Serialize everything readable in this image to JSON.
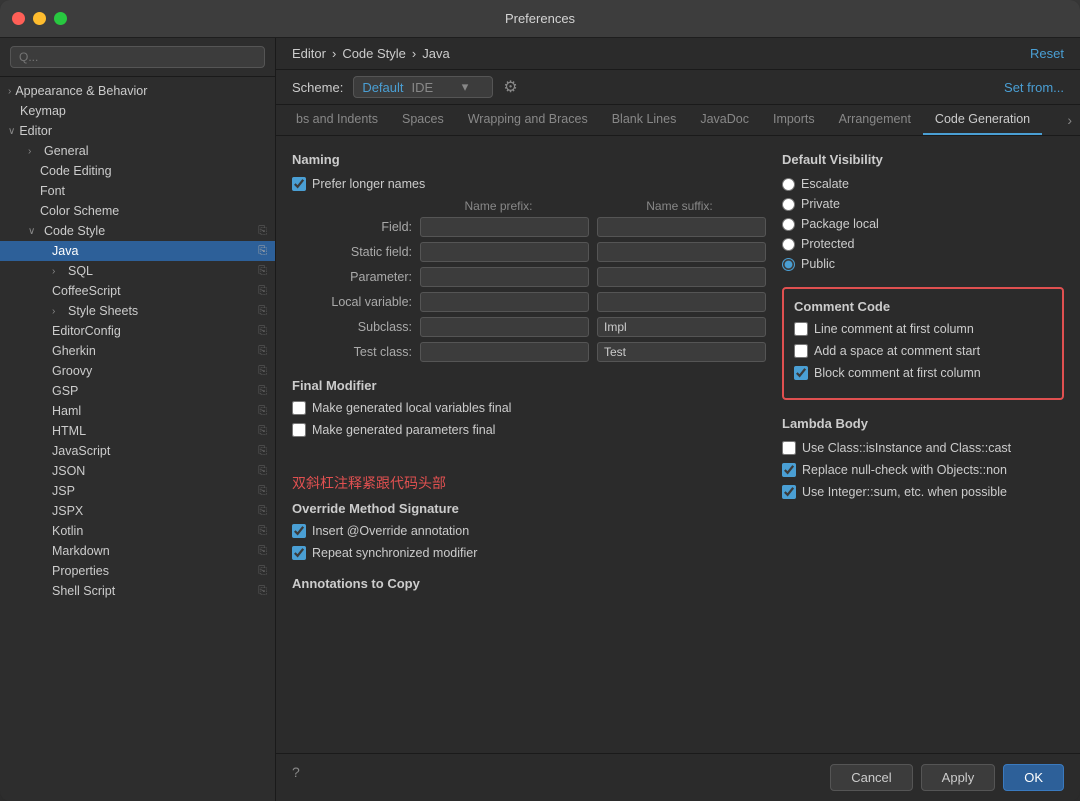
{
  "window": {
    "title": "Preferences"
  },
  "sidebar": {
    "search_placeholder": "Q...",
    "items": [
      {
        "id": "appearance",
        "label": "Appearance & Behavior",
        "indent": 0,
        "arrow": "›",
        "bold": true
      },
      {
        "id": "keymap",
        "label": "Keymap",
        "indent": 1,
        "arrow": ""
      },
      {
        "id": "editor",
        "label": "Editor",
        "indent": 0,
        "arrow": "∨",
        "bold": true
      },
      {
        "id": "general",
        "label": "General",
        "indent": 1,
        "arrow": "›"
      },
      {
        "id": "code-editing",
        "label": "Code Editing",
        "indent": 2,
        "arrow": ""
      },
      {
        "id": "font",
        "label": "Font",
        "indent": 2,
        "arrow": ""
      },
      {
        "id": "color-scheme",
        "label": "Color Scheme",
        "indent": 2,
        "arrow": ""
      },
      {
        "id": "code-style",
        "label": "Code Style",
        "indent": 1,
        "arrow": "∨"
      },
      {
        "id": "java",
        "label": "Java",
        "indent": 2,
        "arrow": "",
        "selected": true
      },
      {
        "id": "sql",
        "label": "SQL",
        "indent": 2,
        "arrow": "›"
      },
      {
        "id": "coffeescript",
        "label": "CoffeeScript",
        "indent": 2,
        "arrow": ""
      },
      {
        "id": "style-sheets",
        "label": "Style Sheets",
        "indent": 2,
        "arrow": "›"
      },
      {
        "id": "editorconfig",
        "label": "EditorConfig",
        "indent": 2,
        "arrow": ""
      },
      {
        "id": "gherkin",
        "label": "Gherkin",
        "indent": 2,
        "arrow": ""
      },
      {
        "id": "groovy",
        "label": "Groovy",
        "indent": 2,
        "arrow": ""
      },
      {
        "id": "gsp",
        "label": "GSP",
        "indent": 2,
        "arrow": ""
      },
      {
        "id": "haml",
        "label": "Haml",
        "indent": 2,
        "arrow": ""
      },
      {
        "id": "html",
        "label": "HTML",
        "indent": 2,
        "arrow": ""
      },
      {
        "id": "javascript",
        "label": "JavaScript",
        "indent": 2,
        "arrow": ""
      },
      {
        "id": "json",
        "label": "JSON",
        "indent": 2,
        "arrow": ""
      },
      {
        "id": "jsp",
        "label": "JSP",
        "indent": 2,
        "arrow": ""
      },
      {
        "id": "jspx",
        "label": "JSPX",
        "indent": 2,
        "arrow": ""
      },
      {
        "id": "kotlin",
        "label": "Kotlin",
        "indent": 2,
        "arrow": ""
      },
      {
        "id": "markdown",
        "label": "Markdown",
        "indent": 2,
        "arrow": ""
      },
      {
        "id": "properties",
        "label": "Properties",
        "indent": 2,
        "arrow": ""
      },
      {
        "id": "shell-script",
        "label": "Shell Script",
        "indent": 2,
        "arrow": ""
      }
    ]
  },
  "breadcrumb": {
    "parts": [
      "Editor",
      "Code Style",
      "Java"
    ],
    "separators": [
      "›",
      "›"
    ]
  },
  "reset_label": "Reset",
  "scheme": {
    "label": "Scheme:",
    "default_text": "Default",
    "ide_text": "IDE",
    "gear_icon": "⚙"
  },
  "set_from_label": "Set from...",
  "tabs": [
    {
      "id": "tabs-indents",
      "label": "bs and Indents"
    },
    {
      "id": "spaces",
      "label": "Spaces"
    },
    {
      "id": "wrapping",
      "label": "Wrapping and Braces"
    },
    {
      "id": "blank-lines",
      "label": "Blank Lines"
    },
    {
      "id": "javadoc",
      "label": "JavaDoc"
    },
    {
      "id": "imports",
      "label": "Imports"
    },
    {
      "id": "arrangement",
      "label": "Arrangement"
    },
    {
      "id": "code-generation",
      "label": "Code Generation",
      "active": true
    }
  ],
  "naming": {
    "title": "Naming",
    "prefer_longer": "Prefer longer names",
    "prefer_longer_checked": true,
    "col_prefix": "Name prefix:",
    "col_suffix": "Name suffix:",
    "rows": [
      {
        "label": "Field:",
        "prefix": "",
        "suffix": ""
      },
      {
        "label": "Static field:",
        "prefix": "",
        "suffix": ""
      },
      {
        "label": "Parameter:",
        "prefix": "",
        "suffix": ""
      },
      {
        "label": "Local variable:",
        "prefix": "",
        "suffix": ""
      },
      {
        "label": "Subclass:",
        "prefix": "",
        "suffix": "Impl"
      },
      {
        "label": "Test class:",
        "prefix": "",
        "suffix": "Test"
      }
    ]
  },
  "default_visibility": {
    "title": "Default Visibility",
    "options": [
      {
        "label": "Escalate",
        "selected": false
      },
      {
        "label": "Private",
        "selected": false
      },
      {
        "label": "Package local",
        "selected": false
      },
      {
        "label": "Protected",
        "selected": false
      },
      {
        "label": "Public",
        "selected": true
      }
    ]
  },
  "final_modifier": {
    "title": "Final Modifier",
    "options": [
      {
        "label": "Make generated local variables final",
        "checked": false
      },
      {
        "label": "Make generated parameters final",
        "checked": false
      }
    ]
  },
  "comment_code": {
    "title": "Comment Code",
    "options": [
      {
        "label": "Line comment at first column",
        "checked": false
      },
      {
        "label": "Add a space at comment start",
        "checked": false
      },
      {
        "label": "Block comment at first column",
        "checked": true
      }
    ]
  },
  "chinese_annotation": "双斜杠注释紧跟代码头部",
  "override_method": {
    "title": "Override Method Signature",
    "options": [
      {
        "label": "Insert @Override annotation",
        "checked": true
      },
      {
        "label": "Repeat synchronized modifier",
        "checked": true
      }
    ]
  },
  "annotations_to_copy": {
    "title": "Annotations to Copy"
  },
  "lambda_body": {
    "title": "Lambda Body",
    "options": [
      {
        "label": "Use Class::isInstance and Class::cast",
        "checked": false
      },
      {
        "label": "Replace null-check with Objects::non",
        "checked": true
      },
      {
        "label": "Use Integer::sum, etc. when possible",
        "checked": true
      }
    ]
  },
  "buttons": {
    "cancel": "Cancel",
    "apply": "Apply",
    "ok": "OK"
  }
}
